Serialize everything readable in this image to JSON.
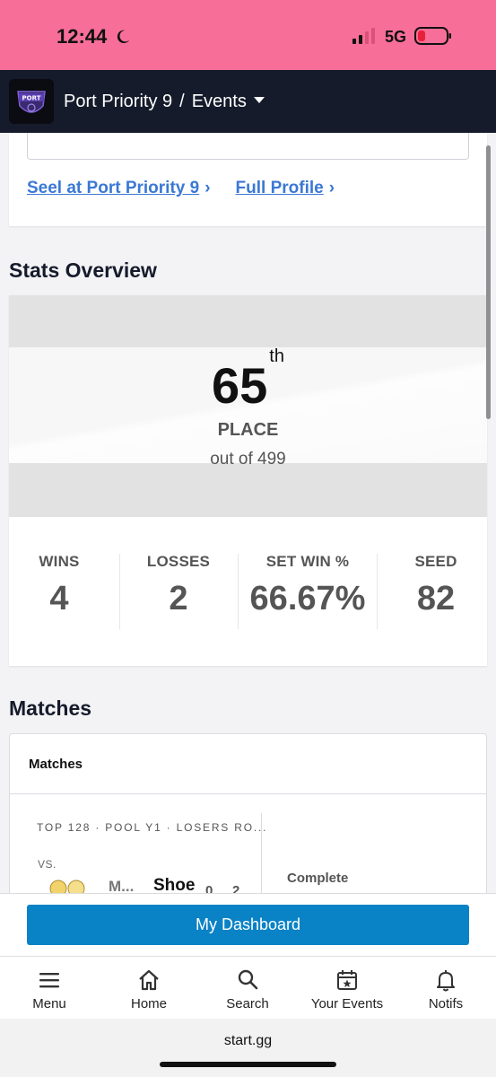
{
  "status_bar": {
    "time": "12:44",
    "network": "5G"
  },
  "header": {
    "logo_text": "PORT",
    "tournament": "Port Priority 9",
    "separator": "/",
    "section": "Events"
  },
  "profile_links": {
    "seed_link_prefix": "Seel at",
    "seed_link_target": "Port Priority 9",
    "full_profile": "Full Profile"
  },
  "stats": {
    "section_title": "Stats Overview",
    "place": "65",
    "place_suffix": "th",
    "place_label": "PLACE",
    "out_of": "out of 499",
    "items": [
      {
        "label": "WINS",
        "value": "4"
      },
      {
        "label": "LOSSES",
        "value": "2"
      },
      {
        "label": "SET WIN %",
        "value": "66.67%"
      },
      {
        "label": "SEED",
        "value": "82"
      }
    ]
  },
  "matches": {
    "section_title": "Matches",
    "card_title": "Matches",
    "round": "TOP 128 · POOL Y1 · LOSERS RO...",
    "vs_label": "VS.",
    "opponent_short": "M...",
    "player": "Shoe",
    "score_a": "0",
    "score_b": "2",
    "status": "Complete"
  },
  "dashboard_button": "My Dashboard",
  "nav": [
    {
      "label": "Menu",
      "icon": "menu-icon"
    },
    {
      "label": "Home",
      "icon": "home-icon"
    },
    {
      "label": "Search",
      "icon": "search-icon"
    },
    {
      "label": "Your Events",
      "icon": "calendar-star-icon"
    },
    {
      "label": "Notifs",
      "icon": "bell-icon"
    }
  ],
  "browser": {
    "url": "start.gg"
  },
  "colors": {
    "status_bar": "#f76e98",
    "header_bg": "#151b2b",
    "link": "#3b78d4",
    "primary_button": "#0a82c6"
  }
}
